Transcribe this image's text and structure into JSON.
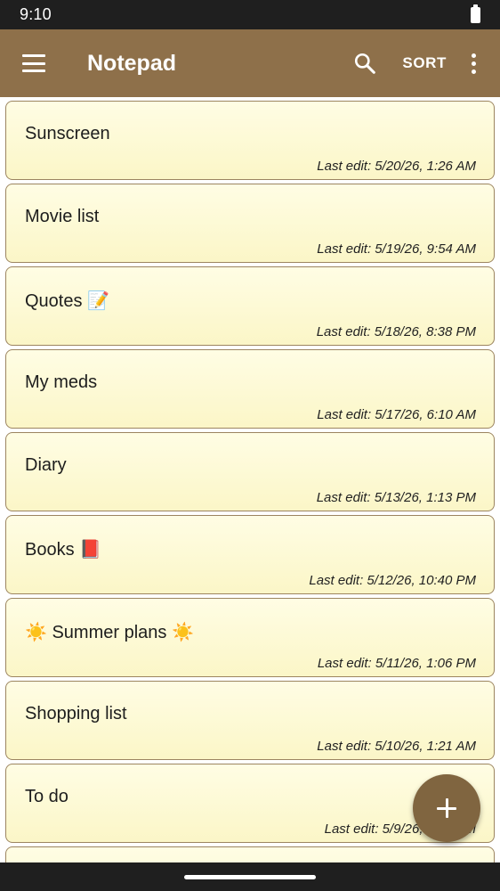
{
  "status_bar": {
    "time": "9:10"
  },
  "app_bar": {
    "title": "Notepad",
    "sort_label": "SORT"
  },
  "notes": [
    {
      "title": "Sunscreen",
      "last_edit": "Last edit: 5/20/26, 1:26 AM"
    },
    {
      "title": "Movie list",
      "last_edit": "Last edit: 5/19/26, 9:54 AM"
    },
    {
      "title": "Quotes 📝",
      "last_edit": "Last edit: 5/18/26, 8:38 PM"
    },
    {
      "title": "My meds",
      "last_edit": "Last edit: 5/17/26, 6:10 AM"
    },
    {
      "title": "Diary",
      "last_edit": "Last edit: 5/13/26, 1:13 PM"
    },
    {
      "title": "Books 📕",
      "last_edit": "Last edit: 5/12/26, 10:40 PM"
    },
    {
      "title": "☀️ Summer plans ☀️",
      "last_edit": "Last edit: 5/11/26, 1:06 PM"
    },
    {
      "title": "Shopping list",
      "last_edit": "Last edit: 5/10/26, 1:21 AM"
    },
    {
      "title": "To do",
      "last_edit": "Last edit: 5/9/26, 8:04 AM"
    },
    {
      "title": "",
      "last_edit": ""
    }
  ],
  "colors": {
    "app_bar": "#8e704a",
    "card_bg": "#fdf9d0",
    "card_border": "#9c8560",
    "fab": "#806540"
  },
  "icons": [
    "menu-icon",
    "search-icon",
    "more-vert-icon",
    "plus-icon",
    "battery-icon"
  ]
}
